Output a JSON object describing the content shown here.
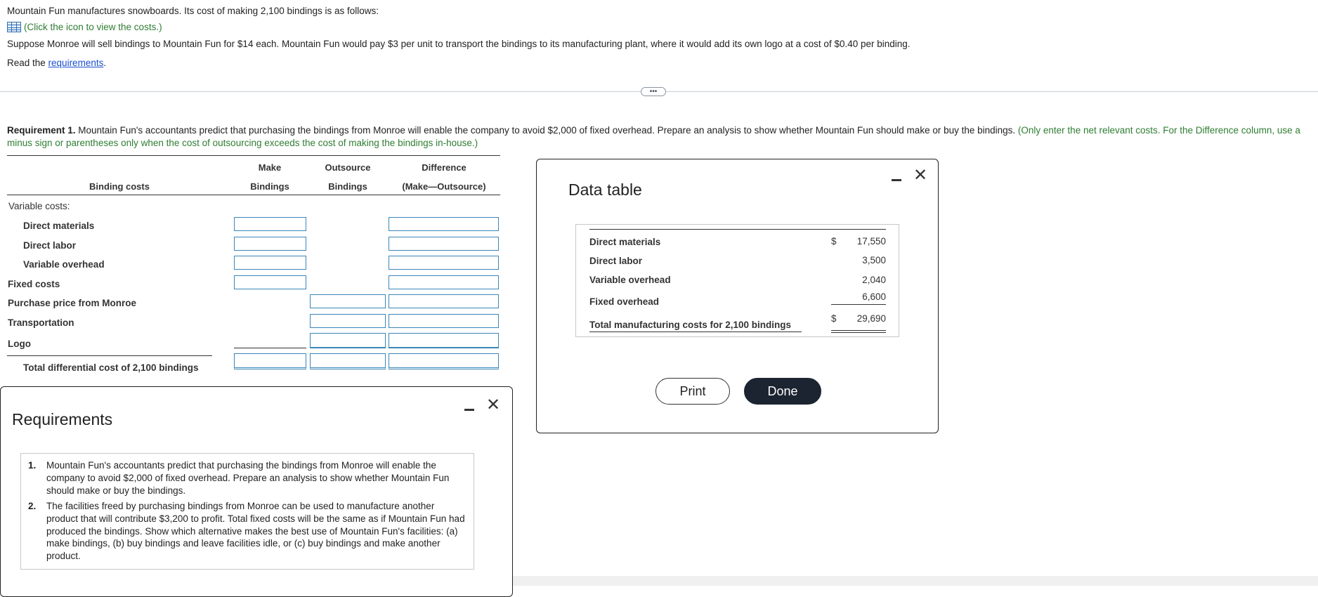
{
  "intro": {
    "line1": "Mountain Fun manufactures snowboards. Its cost of making 2,100 bindings is as follows:",
    "costs_link": "(Click the icon to view the costs.)",
    "line2": "Suppose Monroe will sell bindings to Mountain Fun for $14 each. Mountain Fun would pay $3 per unit to transport the bindings to its manufacturing plant, where it would add its own logo at a cost of $0.40 per binding.",
    "read_prefix": "Read the ",
    "requirements_link": "requirements",
    "read_suffix": "."
  },
  "expand_label": "•••",
  "requirement1": {
    "bold": "Requirement 1.",
    "text": " Mountain Fun's accountants predict that purchasing the bindings from Monroe will enable the company to avoid $2,000 of fixed overhead. Prepare an analysis to show whether Mountain Fun should make or buy the bindings. ",
    "hint": "(Only enter the net relevant costs. For the Difference column, use a minus sign or parentheses only when the cost of outsourcing exceeds the cost of making the bindings in-house.)"
  },
  "analysis": {
    "col_header_label": "Binding costs",
    "col1_line1": "Make",
    "col1_line2": "Bindings",
    "col2_line1": "Outsource",
    "col2_line2": "Bindings",
    "col3_line1": "Difference",
    "col3_line2": "(Make—Outsource)",
    "rows": {
      "variable_costs": "Variable costs:",
      "direct_materials": "Direct materials",
      "direct_labor": "Direct labor",
      "variable_overhead": "Variable overhead",
      "fixed_costs": "Fixed costs",
      "purchase_price": "Purchase price from Monroe",
      "transportation": "Transportation",
      "logo": "Logo",
      "total": "Total differential cost of 2,100 bindings"
    }
  },
  "data_table": {
    "title": "Data table",
    "rows": [
      {
        "label": "Direct materials",
        "value": "17,550",
        "dollar": "$"
      },
      {
        "label": "Direct labor",
        "value": "3,500",
        "dollar": ""
      },
      {
        "label": "Variable overhead",
        "value": "2,040",
        "dollar": ""
      },
      {
        "label": "Fixed overhead",
        "value": "6,600",
        "dollar": ""
      },
      {
        "label": "Total manufacturing costs for 2,100 bindings",
        "value": "29,690",
        "dollar": "$"
      }
    ],
    "print_label": "Print",
    "done_label": "Done"
  },
  "requirements_modal": {
    "title": "Requirements",
    "items": [
      {
        "num": "1.",
        "text": "Mountain Fun's accountants predict that purchasing the bindings from Monroe will enable the company to avoid $2,000 of fixed overhead. Prepare an analysis to show whether Mountain Fun should make or buy the bindings."
      },
      {
        "num": "2.",
        "text": "The facilities freed by purchasing bindings from Monroe can be used to manufacture another product that will contribute $3,200 to profit. Total fixed costs will be the same as if Mountain Fun had produced the bindings. Show which alternative makes the best use of Mountain Fun's facilities: (a) make bindings, (b) buy bindings and leave facilities idle, or (c) buy bindings and make another product."
      }
    ]
  },
  "colors": {
    "hint_green": "#2e7d32",
    "link_blue": "#1a4fd0",
    "input_border": "#3a86b8",
    "done_bg": "#1b2430"
  }
}
